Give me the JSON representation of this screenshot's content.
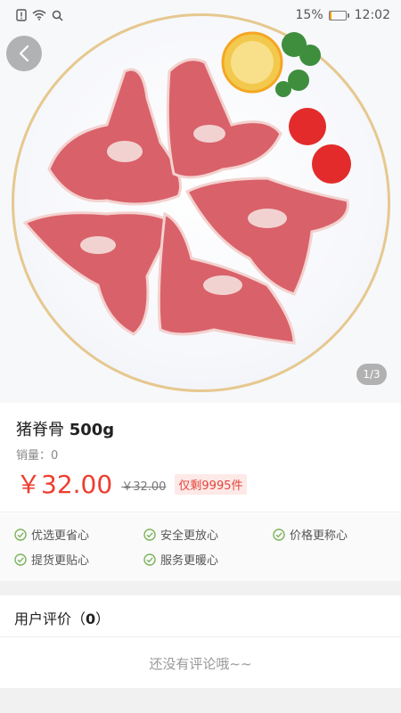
{
  "status_bar": {
    "battery": "15%",
    "battery_level": 0.15,
    "time": "12:02",
    "icons": [
      "alert-icon",
      "wifi-icon",
      "search-icon"
    ]
  },
  "gallery": {
    "pager": "1/3",
    "back_icon": "chevron-left-icon"
  },
  "product": {
    "name": "猪脊骨",
    "weight": "500g",
    "sales_label": "销量：",
    "sales_value": "0",
    "currency": "￥",
    "price": "32.00",
    "original_price": "￥32.00",
    "stock": "仅剩9995件"
  },
  "guarantees": [
    {
      "label": "优选更省心",
      "icon": "check-circle-icon"
    },
    {
      "label": "安全更放心",
      "icon": "check-circle-icon"
    },
    {
      "label": "价格更称心",
      "icon": "check-circle-icon"
    },
    {
      "label": "提货更贴心",
      "icon": "check-circle-icon"
    },
    {
      "label": "服务更暖心",
      "icon": "check-circle-icon"
    }
  ],
  "reviews": {
    "title_prefix": "用户评价（",
    "count": "0",
    "title_suffix": "）",
    "empty_text": "还没有评论哦~~"
  },
  "colors": {
    "price": "#ee3d2f",
    "accent_check": "#7bb35a",
    "stock_badge_bg": "#fde9e7"
  }
}
